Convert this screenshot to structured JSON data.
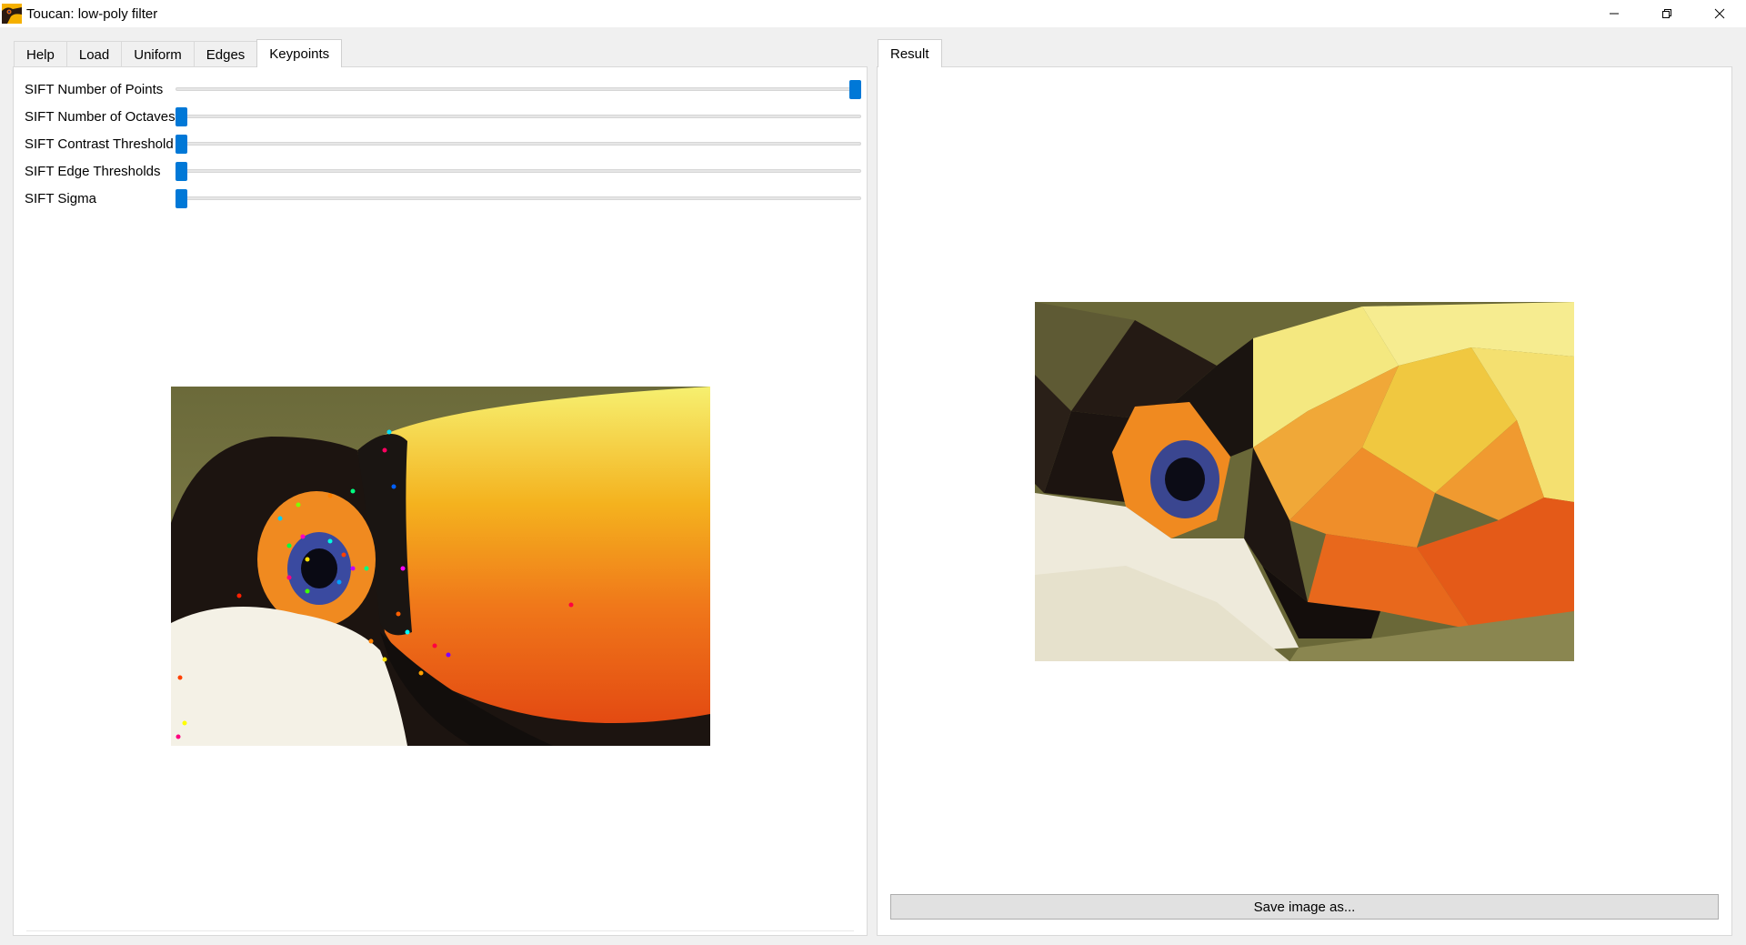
{
  "window": {
    "title": "Toucan: low-poly filter",
    "controls": [
      "minimize-icon",
      "restore-icon",
      "close-icon"
    ]
  },
  "left_panel": {
    "tabs": [
      {
        "label": "Help",
        "active": false
      },
      {
        "label": "Load",
        "active": false
      },
      {
        "label": "Uniform",
        "active": false
      },
      {
        "label": "Edges",
        "active": false
      },
      {
        "label": "Keypoints",
        "active": true
      }
    ],
    "sliders": [
      {
        "label": "SIFT Number of Points",
        "value": 1.0
      },
      {
        "label": "SIFT Number of Octaves",
        "value": 0.0
      },
      {
        "label": "SIFT Contrast Threshold",
        "value": 0.0
      },
      {
        "label": "SIFT Edge Thresholds",
        "value": 0.0
      },
      {
        "label": "SIFT Sigma",
        "value": 0.0
      }
    ],
    "image": "toucan-keypoints-image"
  },
  "right_panel": {
    "tabs": [
      {
        "label": "Result",
        "active": true
      }
    ],
    "image": "toucan-low-poly-result-image",
    "save_label": "Save image as..."
  },
  "colors": {
    "accent": "#0078d7",
    "pane_background": "#ffffff",
    "window_background": "#f0f0f0"
  }
}
